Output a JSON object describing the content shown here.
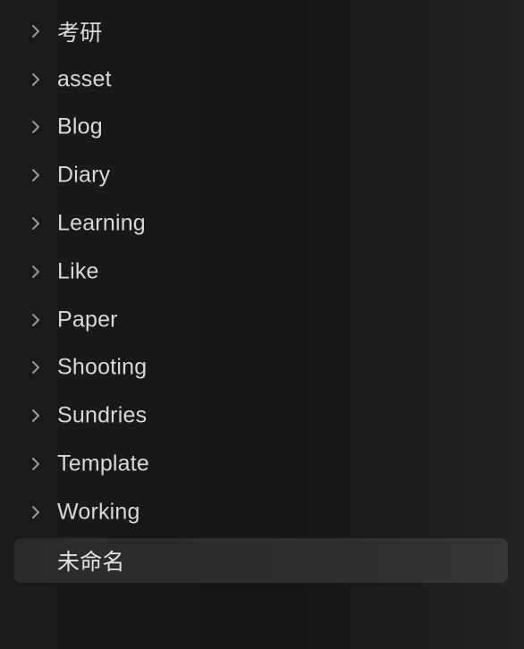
{
  "file_tree": {
    "items": [
      {
        "label": "考研",
        "kind": "folder",
        "icon": "chevron-right-icon"
      },
      {
        "label": "asset",
        "kind": "folder",
        "icon": "chevron-right-icon"
      },
      {
        "label": "Blog",
        "kind": "folder",
        "icon": "chevron-right-icon"
      },
      {
        "label": "Diary",
        "kind": "folder",
        "icon": "chevron-right-icon"
      },
      {
        "label": "Learning",
        "kind": "folder",
        "icon": "chevron-right-icon"
      },
      {
        "label": "Like",
        "kind": "folder",
        "icon": "chevron-right-icon"
      },
      {
        "label": "Paper",
        "kind": "folder",
        "icon": "chevron-right-icon"
      },
      {
        "label": "Shooting",
        "kind": "folder",
        "icon": "chevron-right-icon"
      },
      {
        "label": "Sundries",
        "kind": "folder",
        "icon": "chevron-right-icon"
      },
      {
        "label": "Template",
        "kind": "folder",
        "icon": "chevron-right-icon"
      },
      {
        "label": "Working",
        "kind": "folder",
        "icon": "chevron-right-icon"
      },
      {
        "label": "未命名",
        "kind": "file",
        "selected": true
      }
    ]
  },
  "colors": {
    "background": "#1a1a1a",
    "text": "#d8d8d8",
    "chevron": "#9a9a9a",
    "selected_background": "#2e2e2e"
  }
}
